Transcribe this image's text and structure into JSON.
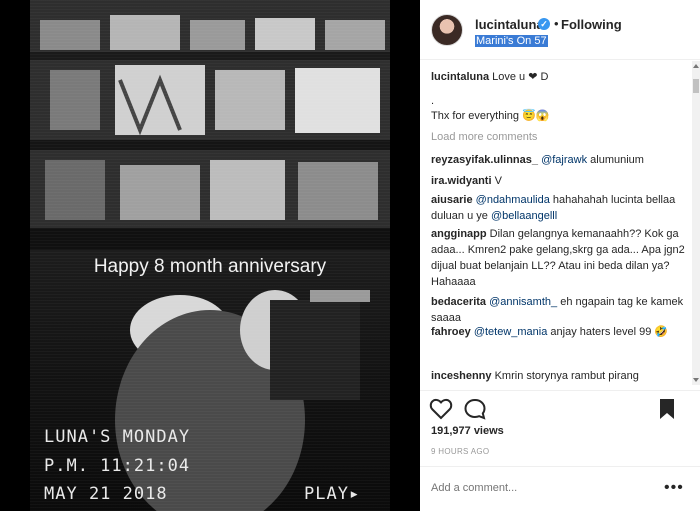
{
  "media": {
    "caption_overlay": "Happy 8 month anniversary",
    "vhs_line1": "LUNA'S MONDAY",
    "vhs_line2": "P.M. 11:21:04",
    "vhs_line3": "MAY 21 2018",
    "vhs_play": "PLAY▸"
  },
  "header": {
    "username": "lucintaluna",
    "verified_icon": "✓",
    "separator": "•",
    "follow_status": "Following",
    "location": "Marini's On 57"
  },
  "comments": [
    {
      "user": "lucintaluna",
      "parts": [
        {
          "text": "Love u ❤ D"
        }
      ]
    },
    {
      "user": "",
      "parts": [
        {
          "text": "."
        }
      ]
    },
    {
      "user": "",
      "parts": [
        {
          "text": "Thx for everything 😇😱"
        }
      ]
    },
    {
      "user": "",
      "parts": [
        {
          "text": "Load more comments"
        }
      ]
    },
    {
      "user": "reyzasyifak.ulinnas_",
      "parts": [
        {
          "text": "@fajrawk",
          "mention": true
        },
        {
          "text": " alumunium"
        }
      ]
    },
    {
      "user": "ira.widyanti",
      "parts": [
        {
          "text": "V"
        }
      ]
    },
    {
      "user": "aiusarie",
      "parts": [
        {
          "text": "@ndahmaulida",
          "mention": true
        },
        {
          "text": " hahahahah lucinta bellaa duluan u ye "
        },
        {
          "text": "@bellaangelll",
          "mention": true
        }
      ]
    },
    {
      "user": "angginapp",
      "parts": [
        {
          "text": "Dilan gelangnya kemanaahh?? Kok ga adaa... Kmren2 pake gelang,skrg ga ada... Apa jgn2 dijual buat belanjain LL?? Atau ini beda dilan ya? Hahaaaa"
        }
      ]
    },
    {
      "user": "bedacerita",
      "parts": [
        {
          "text": "@annisamth_",
          "mention": true
        },
        {
          "text": " eh ngapain tag ke kamek saaaa"
        }
      ]
    },
    {
      "user": "fahroey",
      "parts": [
        {
          "text": "@tetew_mania",
          "mention": true
        },
        {
          "text": " anjay haters level 99 🤣"
        }
      ]
    },
    {
      "user": "inceshenny",
      "parts": [
        {
          "text": "Kmrin storynya rambut pirang"
        }
      ]
    }
  ],
  "actions": {
    "like_icon": "heart-icon",
    "comment_icon": "comment-icon",
    "save_icon": "bookmark-icon"
  },
  "likes": "191,977 views",
  "timestamp": "9 HOURS AGO",
  "add_comment_placeholder": "Add a comment...",
  "more_options": "•••"
}
